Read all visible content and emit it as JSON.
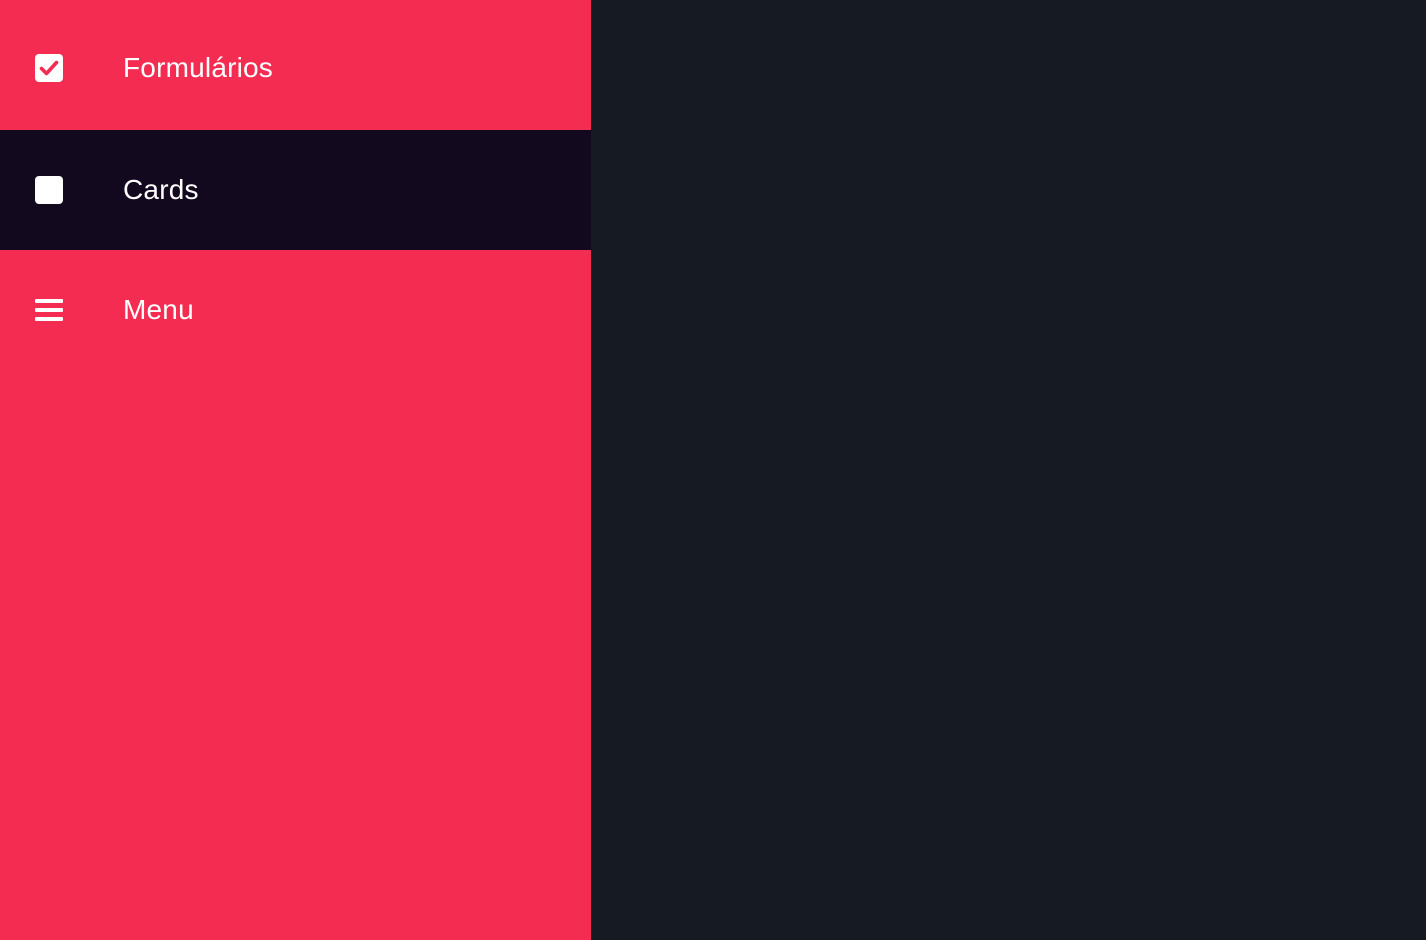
{
  "sidebar": {
    "items": [
      {
        "label": "Formulários",
        "icon": "checkbox-checked-icon",
        "active": false
      },
      {
        "label": "Cards",
        "icon": "checkbox-blank-icon",
        "active": true
      },
      {
        "label": "Menu",
        "icon": "menu-icon",
        "active": false
      }
    ]
  },
  "colors": {
    "sidebar_bg": "#f42c52",
    "active_item_bg": "#13091e",
    "main_bg": "#161a23",
    "text": "#ffffff"
  }
}
